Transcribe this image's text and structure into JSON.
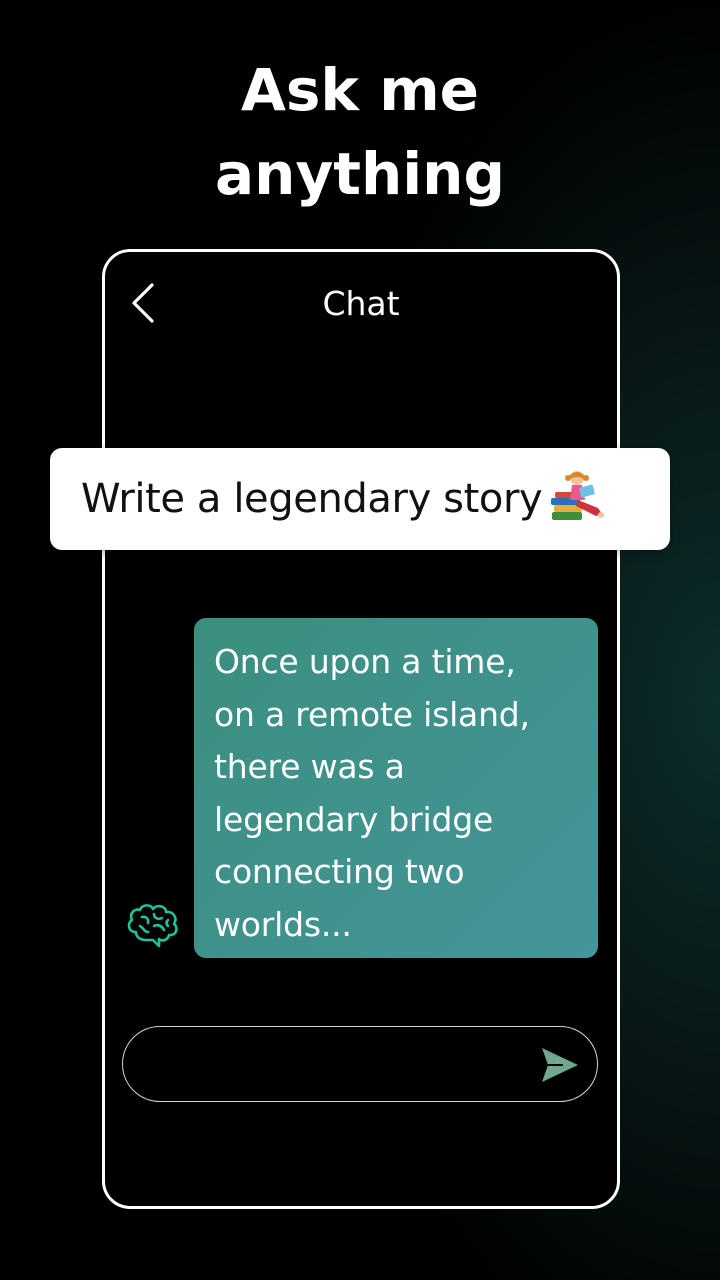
{
  "headline": {
    "line1": "Ask me",
    "line2": "anything"
  },
  "chat": {
    "title": "Chat",
    "back_icon": "chevron-left-icon"
  },
  "prompt": {
    "text": "Write a legendary story",
    "emoji_icon": "girl-reading-books-icon"
  },
  "reply": {
    "text": "Once upon a time,\non a remote island,\nthere was a\nlegendary bridge\nconnecting two\nworlds...",
    "avatar_icon": "brain-icon",
    "color": "#3f928a"
  },
  "input": {
    "placeholder": "",
    "value": "",
    "send_icon": "send-icon",
    "send_color": "#6fa78f"
  }
}
